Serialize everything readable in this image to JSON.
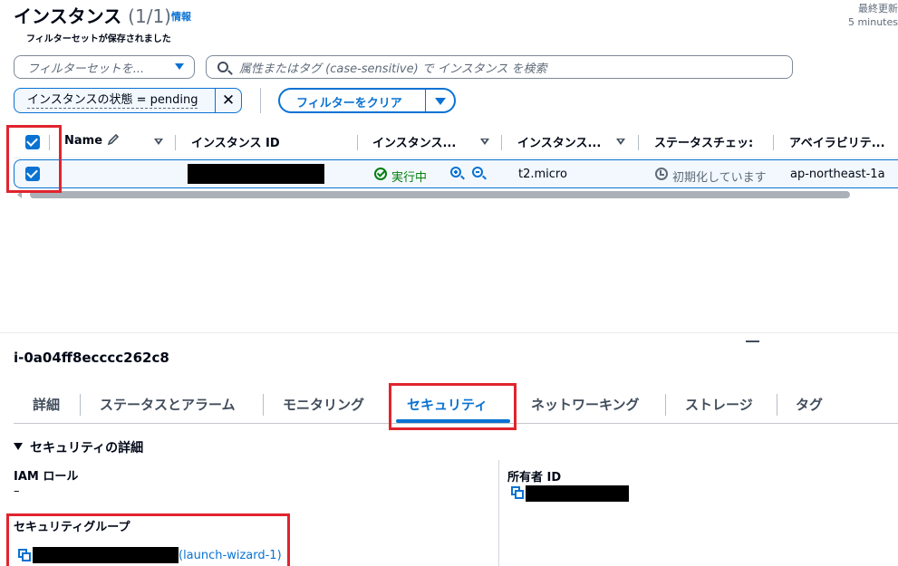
{
  "header": {
    "title": "インスタンス",
    "count": "(1/1)",
    "info_link": "情報",
    "last_updated_label": "最終更新",
    "last_updated_value": "5 minutes"
  },
  "filters": {
    "filterset_label": "フィルターセットが保存されました",
    "filterset_placeholder": "フィルターセットを...",
    "search_placeholder": "属性またはタグ (case-sensitive) で インスタンス を検索",
    "token_label": "インスタンスの状態 = pending",
    "token_close": "✕",
    "clear_button": "フィルターをクリア"
  },
  "table": {
    "columns": [
      "Name",
      "インスタンス ID",
      "インスタンス...",
      "インスタンス...",
      "ステータスチェッ:",
      "アベイラビリテ..."
    ],
    "row": {
      "instance_state": "実行中",
      "instance_type": "t2.micro",
      "status_check": "初期化しています",
      "availability_zone": "ap-northeast-1a"
    }
  },
  "panel": {
    "instance_id": "i-0a04ff8ecccc262c8",
    "tabs": [
      "詳細",
      "ステータスとアラーム",
      "モニタリング",
      "セキュリティ",
      "ネットワーキング",
      "ストレージ",
      "タグ"
    ],
    "active_tab": "セキュリティ",
    "section_title": "セキュリティの詳細",
    "iam_role_label": "IAM ロール",
    "iam_role_value": "–",
    "owner_id_label": "所有者 ID",
    "security_group_label": "セキュリティグループ",
    "security_group_link": "(launch-wizard-1)"
  },
  "colors": {
    "accent": "#0972d3",
    "success": "#037f0c",
    "highlight_box": "#e0242e"
  }
}
